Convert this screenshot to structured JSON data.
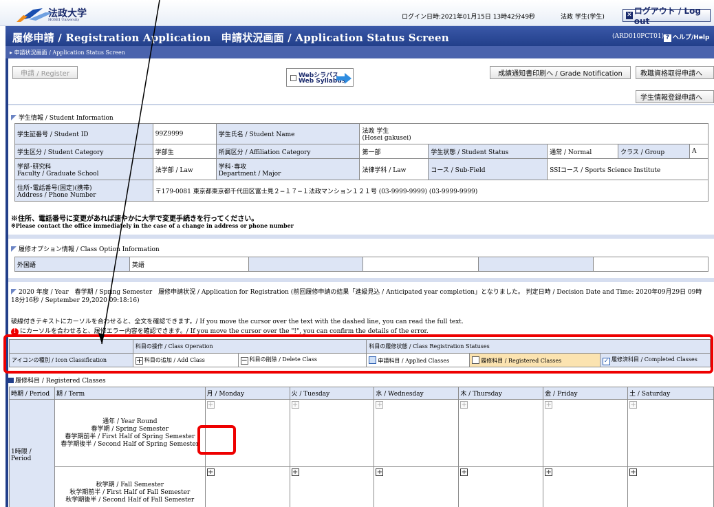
{
  "header": {
    "university_name": "法政大学",
    "university_sub": "HOSEI University",
    "login_info": "ログイン日時:2021年01月15日 13時42分49秒",
    "user_info": "法政 学生(学生)",
    "logout_label": "ログアウト / Log out"
  },
  "titlebar": {
    "title": "履修申請 / Registration Application　申請状況画面 / Application Status Screen",
    "screen_code": "(ARD010PCT01)",
    "help_label": "ヘルプ/Help"
  },
  "breadcrumb": "申請状況画面 / Application Status Screen",
  "toolbar": {
    "register_label": "申請 / Register",
    "websyllabus_jp": "Webシラバス",
    "websyllabus_en": "Web Syllabus",
    "grade_notification_label": "成績通知書印刷へ / Grade Notification",
    "teaching_license_label": "教職資格取得申請へ",
    "student_info_label": "学生情報登録申請へ"
  },
  "student_info": {
    "section_title": "学生情報 / Student Information",
    "student_id_label": "学生証番号 / Student ID",
    "student_id": "99Z9999",
    "name_label": "学生氏名 / Student Name",
    "name": "法政 学生",
    "name_romaji": "(Hosei gakusei)",
    "category_label": "学生区分 / Student Category",
    "category": "学部生",
    "affiliation_label": "所属区分 / Affiliation Category",
    "affiliation": "第一部",
    "status_label": "学生状態 / Student Status",
    "status": "通常 / Normal",
    "class_label": "クラス / Group",
    "class": "A",
    "faculty_label_jp": "学部･研究科",
    "faculty_label_en": "Faculty / Graduate School",
    "faculty": "法学部 / Law",
    "dept_label_jp": "学科･専攻",
    "dept_label_en": "Department / Major",
    "dept": "法律学科 / Law",
    "subfield_label": "コース / Sub-Field",
    "subfield": "SSIコース / Sports Science Institute",
    "address_label_jp": "住所･電話番号(固定)(携帯)",
    "address_label_en": "Address / Phone Number",
    "address": "〒179-0081 東京都東京都千代田区富士見２−１７−１法政マンション１２１号 (03-9999-9999) (03-9999-9999)",
    "notice_jp": "※住所、電話番号に変更があれば速やかに大学で変更手続きを行ってください。",
    "notice_en": "※Please contact the office immediately in the case of a change in address or phone number"
  },
  "class_option": {
    "section_title": "履修オプション情報 / Class Option Information",
    "label": "外国語",
    "value": "英語"
  },
  "application_status": {
    "line": "2020 年度 / Year　春学期 / Spring Semester　履修申請状況 / Application for Registration (前回履修申請の結果「進級見込 / Anticipated year completion」となりました。 判定日時 / Decision Date and Time: 2020年09月29日 09時18分16秒 / September 29,2020 09:18:16)",
    "hint1": "破線付きテキストにカーソルを合わせると、全文を確認できます。/ If you move the cursor over the text with the dashed line, you can read the full text.",
    "hint2": "にカーソルを合わせると、履修エラー内容を確認できます。/ If you move the cursor over the \"!\", you can confirm the details of the error."
  },
  "legend": {
    "operation_header": "科目の操作 / Class Operation",
    "status_header": "科目の履修状態 / Class Registration Statuses",
    "icon_class_label": "アイコンの種別 / Icon Classification",
    "add_class": "科目の追加 / Add Class",
    "delete_class": "科目の削除 / Delete Class",
    "applied": "申請科目 / Applied Classes",
    "registered": "履修科目 / Registered Classes",
    "completed": "履修済科目 / Completed Classes"
  },
  "registered_classes": {
    "section_title": "履修科目 / Registered Classes",
    "period_header": "時期 / Period",
    "term_header": "期 / Term",
    "days": [
      "月 / Monday",
      "火 / Tuesday",
      "水 / Wednesday",
      "木 / Thursday",
      "金 / Friday",
      "土 / Saturday"
    ],
    "period1": "1時限 / Period",
    "spring_terms": [
      "通年 / Year Round",
      "春学期 / Spring Semester",
      "春学期前半 / First Half of Spring Semester",
      "春学期後半 / Second Half of Spring Semester"
    ],
    "fall_terms": [
      "秋学期 / Fall Semester",
      "秋学期前半 / First Half of Fall Semester",
      "秋学期後半 / Second Half of Fall Semester"
    ]
  },
  "colors": {
    "brand_blue": "#223f8a",
    "highlight_red": "#e00000",
    "label_bg": "#dde5f5"
  }
}
